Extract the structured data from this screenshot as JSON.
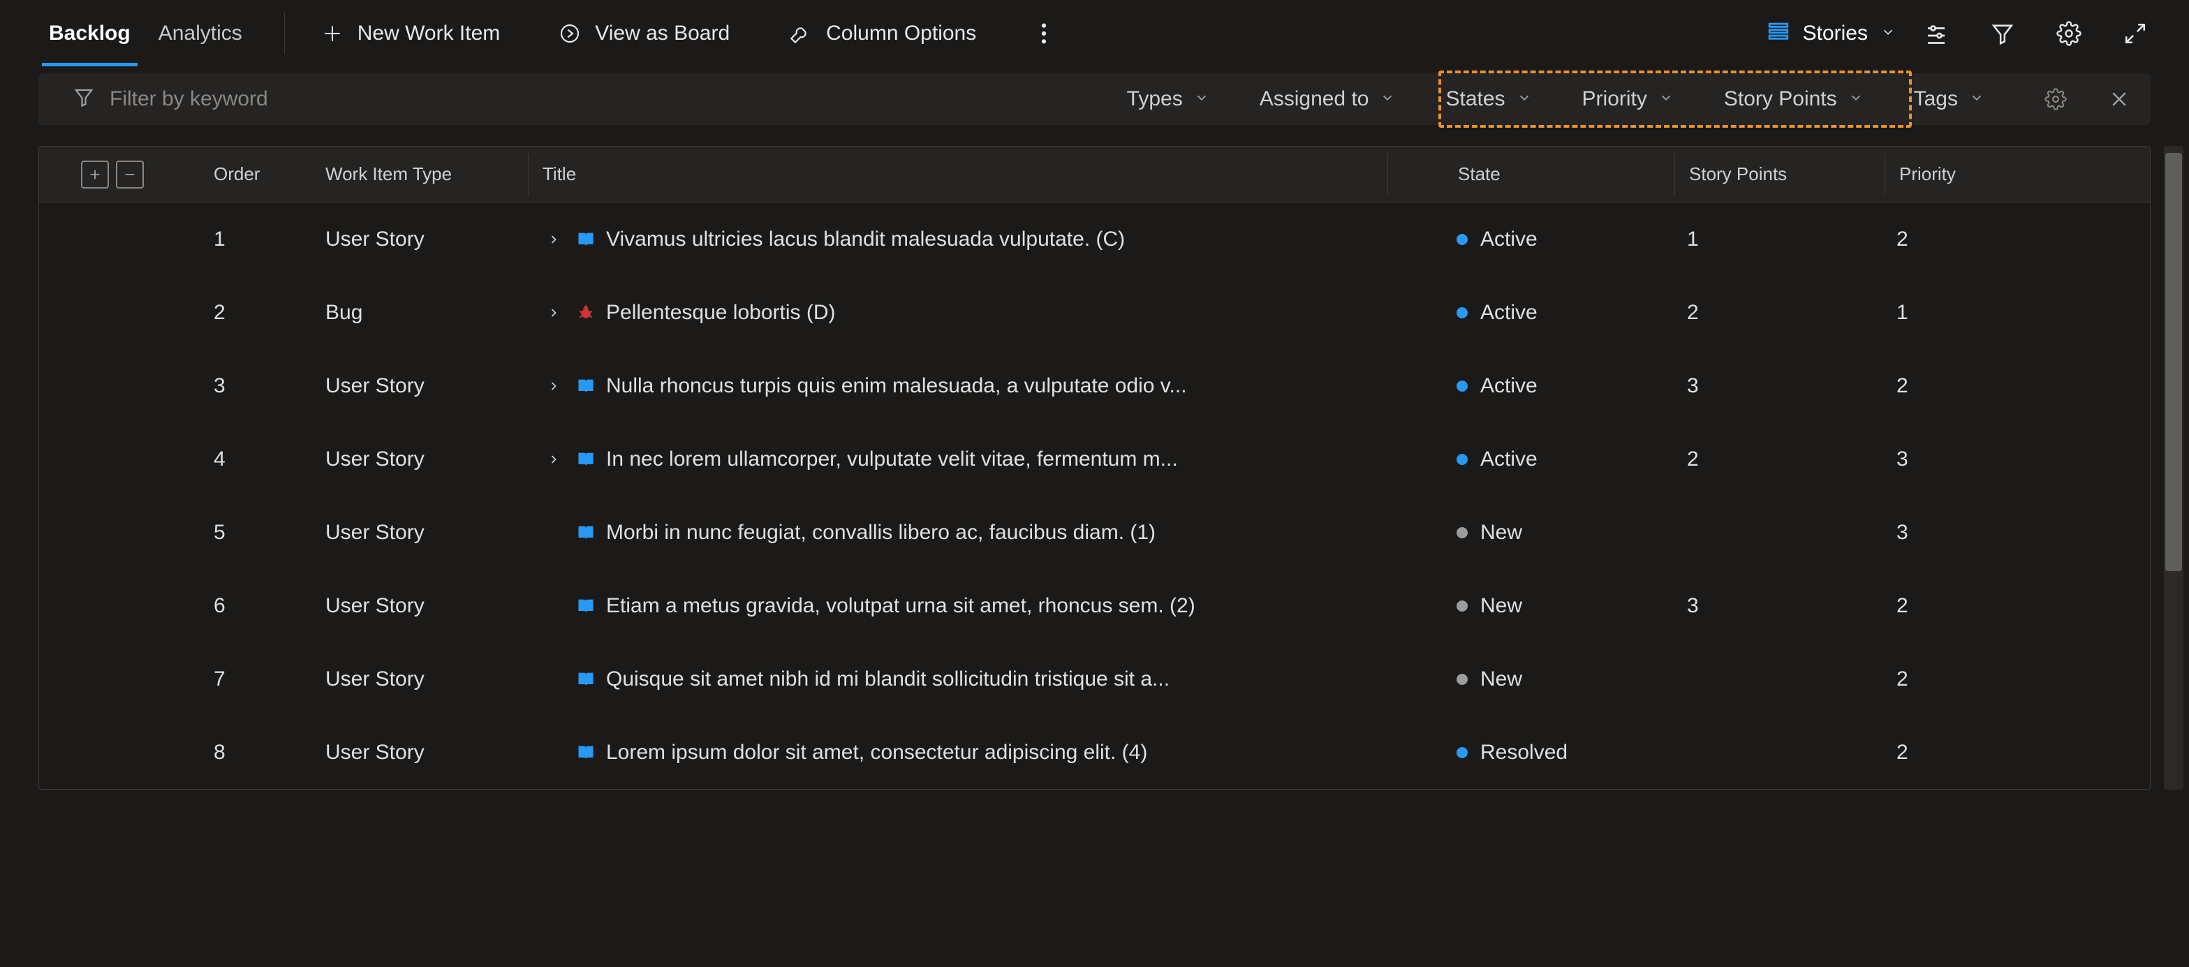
{
  "tabs": {
    "backlog": "Backlog",
    "analytics": "Analytics"
  },
  "toolbar": {
    "new_work_item": "New Work Item",
    "view_as_board": "View as Board",
    "column_options": "Column Options",
    "view_label": "Stories"
  },
  "filters": {
    "placeholder": "Filter by keyword",
    "types": "Types",
    "assigned_to": "Assigned to",
    "states": "States",
    "priority": "Priority",
    "story_points": "Story Points",
    "tags": "Tags"
  },
  "columns": {
    "order": "Order",
    "work_item_type": "Work Item Type",
    "title": "Title",
    "state": "State",
    "story_points": "Story Points",
    "priority": "Priority"
  },
  "state_colors": {
    "Active": "#2899f5",
    "New": "#9c9c9c",
    "Resolved": "#2899f5"
  },
  "type_icons": {
    "User Story": "book",
    "Bug": "bug"
  },
  "rows": [
    {
      "order": "1",
      "type": "User Story",
      "has_children": true,
      "title": "Vivamus ultricies lacus blandit malesuada vulputate. (C)",
      "state": "Active",
      "story_points": "1",
      "priority": "2"
    },
    {
      "order": "2",
      "type": "Bug",
      "has_children": true,
      "title": "Pellentesque lobortis (D)",
      "state": "Active",
      "story_points": "2",
      "priority": "1"
    },
    {
      "order": "3",
      "type": "User Story",
      "has_children": true,
      "title": "Nulla rhoncus turpis quis enim malesuada, a vulputate odio v...",
      "state": "Active",
      "story_points": "3",
      "priority": "2"
    },
    {
      "order": "4",
      "type": "User Story",
      "has_children": true,
      "title": "In nec lorem ullamcorper, vulputate velit vitae, fermentum m...",
      "state": "Active",
      "story_points": "2",
      "priority": "3"
    },
    {
      "order": "5",
      "type": "User Story",
      "has_children": false,
      "title": "Morbi in nunc feugiat, convallis libero ac, faucibus diam. (1)",
      "state": "New",
      "story_points": "",
      "priority": "3"
    },
    {
      "order": "6",
      "type": "User Story",
      "has_children": false,
      "title": "Etiam a metus gravida, volutpat urna sit amet, rhoncus sem. (2)",
      "state": "New",
      "story_points": "3",
      "priority": "2"
    },
    {
      "order": "7",
      "type": "User Story",
      "has_children": false,
      "title": "Quisque sit amet nibh id mi blandit sollicitudin tristique sit a...",
      "state": "New",
      "story_points": "",
      "priority": "2"
    },
    {
      "order": "8",
      "type": "User Story",
      "has_children": false,
      "title": "Lorem ipsum dolor sit amet, consectetur adipiscing elit. (4)",
      "state": "Resolved",
      "story_points": "",
      "priority": "2"
    }
  ]
}
